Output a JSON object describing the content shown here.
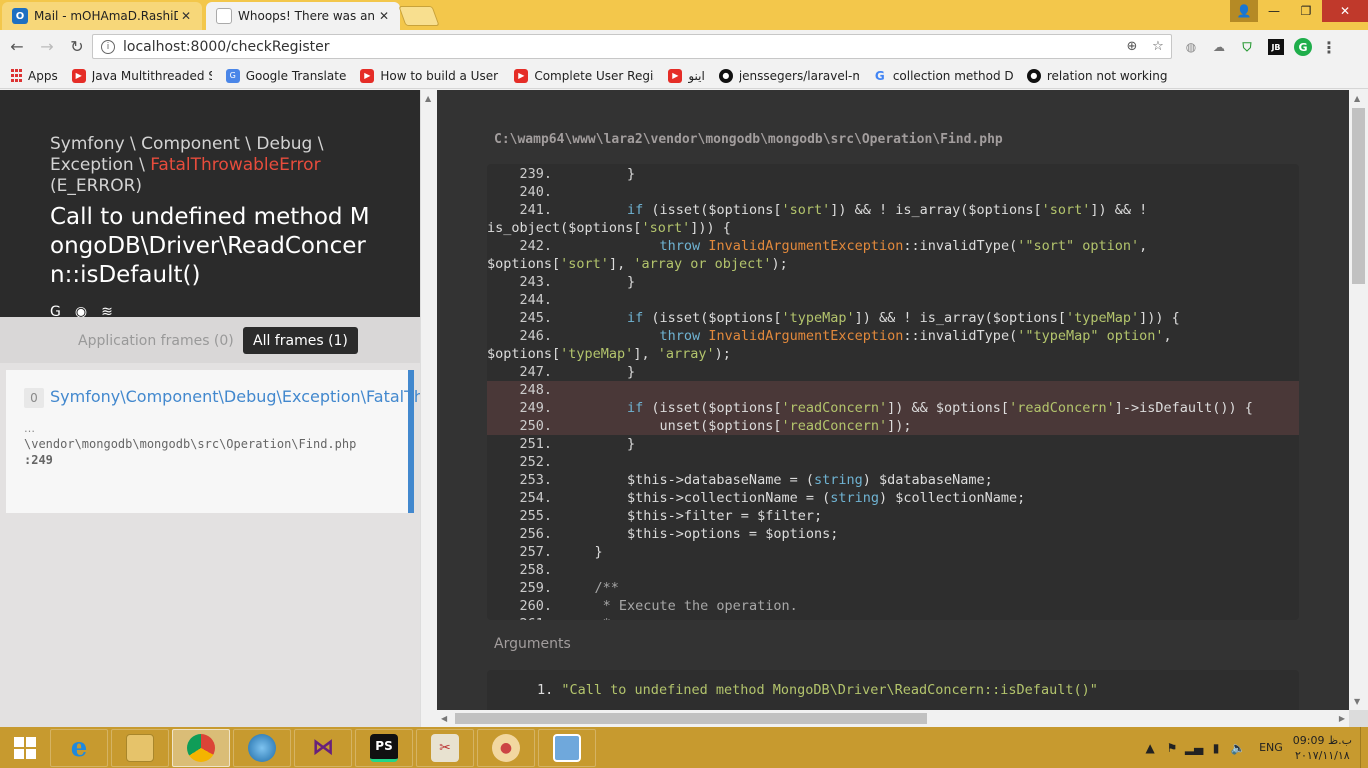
{
  "browser": {
    "tabs": [
      {
        "title": "Mail - mOHAmaD.RashiD",
        "favicon": "outlook-icon",
        "active": false
      },
      {
        "title": "Whoops! There was an e",
        "favicon": "page-icon",
        "active": true
      }
    ],
    "window_controls": {
      "user": "👤",
      "minimize": "—",
      "restore": "❐",
      "close": "✕"
    },
    "nav": {
      "back": "←",
      "forward": "→",
      "reload": "↻"
    },
    "url": "localhost:8000/checkRegister",
    "info_icon": "i",
    "bookmarks": [
      {
        "label": "Apps",
        "icon": "apps-icon"
      },
      {
        "label": "Java Multithreaded S",
        "icon": "youtube-icon"
      },
      {
        "label": "Google Translate",
        "icon": "translate-icon"
      },
      {
        "label": "How to build a User F",
        "icon": "youtube-icon"
      },
      {
        "label": "Complete User Regist",
        "icon": "youtube-icon"
      },
      {
        "label": "اینو",
        "icon": "youtube-icon"
      },
      {
        "label": "jenssegers/laravel-m",
        "icon": "github-icon"
      },
      {
        "label": "collection method DE",
        "icon": "google-icon"
      },
      {
        "label": "relation not working",
        "icon": "github-icon"
      }
    ]
  },
  "whoops": {
    "namespace_part1": "Symfony \\ Component \\ Debug \\",
    "namespace_part2": "Exception \\ ",
    "exception_class": "FatalThrowableError",
    "error_type": "(E_ERROR)",
    "message": "Call to undefined method MongoDB\\Driver\\ReadConcern::isDefault()",
    "frame_tabs": {
      "application": "Application frames (0)",
      "all": "All frames (1)"
    },
    "frame": {
      "index": "0",
      "class": "Symfony\\Component\\Debug\\Exception\\FatalThrowableError",
      "ellipsis": "…",
      "file": "\\vendor\\mongodb\\mongodb\\src\\Operation\\Find.php",
      "line": ":249"
    },
    "file_path": "C:\\wamp64\\www\\lara2\\vendor\\mongodb\\mongodb\\src\\Operation\\Find.php",
    "arguments_title": "Arguments",
    "argument_index": "1.",
    "argument_value": "\"Call to undefined method MongoDB\\Driver\\ReadConcern::isDefault()\""
  },
  "taskbar": {
    "language": "ENG",
    "time": "09:09 ب.ظ",
    "date": "۲۰۱۷/۱۱/۱۸"
  }
}
